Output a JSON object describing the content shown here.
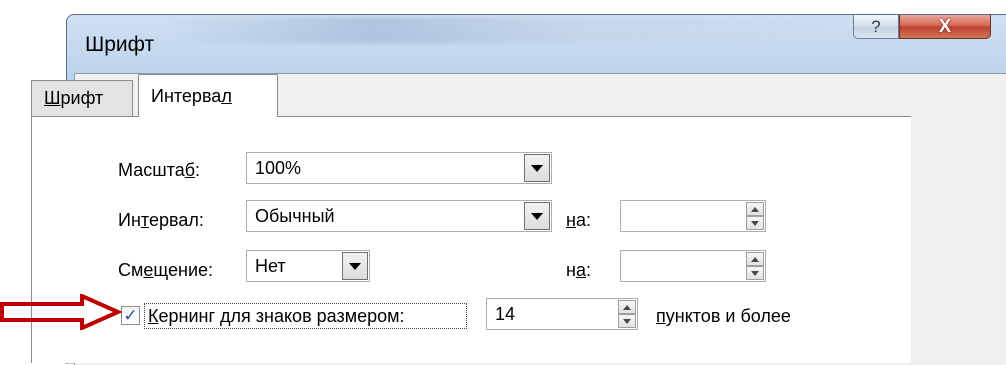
{
  "window": {
    "title": "Шрифт",
    "help_label": "?",
    "close_label": "X"
  },
  "tabs": [
    {
      "label_pre": "",
      "label_u": "Ш",
      "label_post": "рифт",
      "active": false
    },
    {
      "label_pre": "Интерва",
      "label_u": "л",
      "label_post": "",
      "active": true
    }
  ],
  "form": {
    "scale": {
      "label_pre": "Масшта",
      "label_u": "б",
      "label_post": ":",
      "value": "100%"
    },
    "spacing": {
      "label_pre": "Ин",
      "label_u": "т",
      "label_post": "ервал:",
      "value": "Обычный",
      "by_label_pre": "",
      "by_label_u": "н",
      "by_label_post": "а:",
      "by_value": ""
    },
    "position": {
      "label_pre": "См",
      "label_u": "е",
      "label_post": "щение:",
      "value": "Нет",
      "by_label_pre": "н",
      "by_label_u": "а",
      "by_label_post": ":",
      "by_value": ""
    },
    "kerning": {
      "checked": true,
      "check_glyph": "✓",
      "label_pre": "",
      "label_u": "К",
      "label_post": "ернинг для знаков размером:",
      "value": "14",
      "suffix_pre": "",
      "suffix_u": "п",
      "suffix_post": "унктов и более"
    }
  },
  "colors": {
    "arrow": "#c00000",
    "close_button": "#c0432b"
  }
}
